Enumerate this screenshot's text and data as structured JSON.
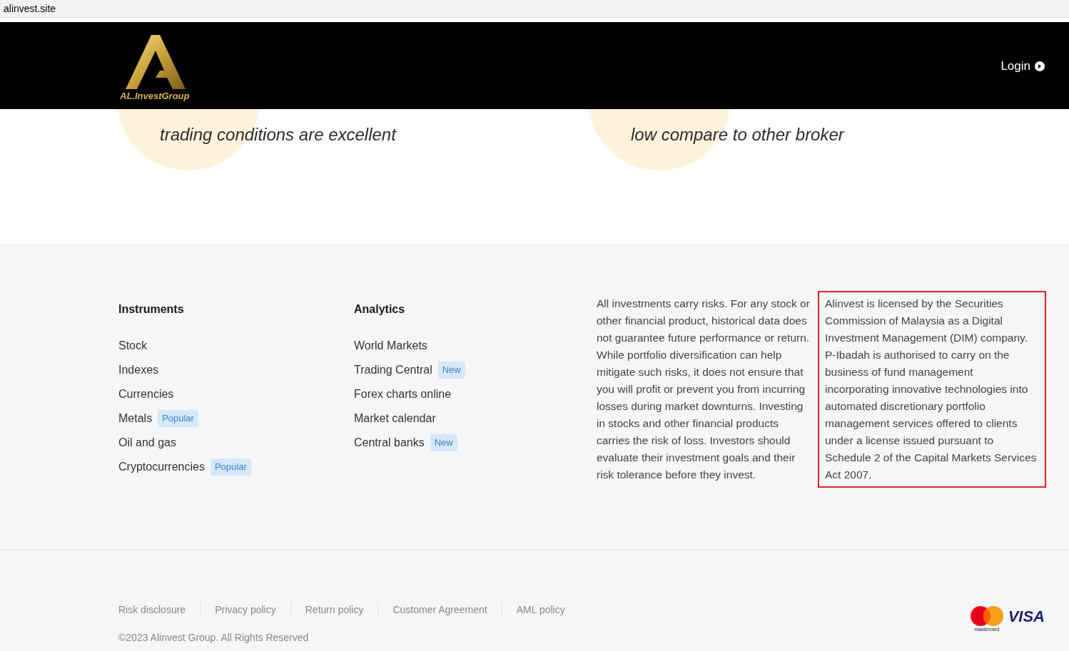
{
  "address_bar": {
    "url": "alinvest.site"
  },
  "header": {
    "logo_text": "AL.InvestGroup",
    "login": "Login"
  },
  "testimonials": [
    {
      "text": "trading conditions are excellent"
    },
    {
      "text": "low compare to other broker"
    }
  ],
  "footer": {
    "columns": [
      {
        "title": "Instruments",
        "items": [
          {
            "label": "Stock"
          },
          {
            "label": "Indexes"
          },
          {
            "label": "Currencies"
          },
          {
            "label": "Metals",
            "badge": "Popular"
          },
          {
            "label": "Oil and gas"
          },
          {
            "label": "Cryptocurrencies",
            "badge": "Popular"
          }
        ]
      },
      {
        "title": "Analytics",
        "items": [
          {
            "label": "World Markets"
          },
          {
            "label": "Trading Central",
            "badge": "New"
          },
          {
            "label": "Forex charts online"
          },
          {
            "label": "Market calendar"
          },
          {
            "label": "Central banks",
            "badge": "New"
          }
        ]
      }
    ],
    "notices": [
      {
        "text": "All investments carry risks. For any stock or other financial product, historical data does not guarantee future performance or return. While portfolio diversification can help mitigate such risks, it does not ensure that you will profit or prevent you from incurring losses during market downturns. Investing in stocks and other financial products carries the risk of loss. Investors should evaluate their investment goals and their risk tolerance before they invest.",
        "highlighted": false
      },
      {
        "text": "Alinvest is licensed by the Securities Commission of Malaysia as a Digital Investment Management (DIM) company. P-Ibadah is authorised to carry on the business of fund management incorporating innovative technologies into automated discretionary portfolio management services offered to clients under a license issued pursuant to Schedule 2 of the Capital Markets Services Act 2007.",
        "highlighted": true
      }
    ],
    "links": [
      "Risk disclosure",
      "Privacy policy",
      "Return policy",
      "Customer Agreement",
      "AML policy"
    ],
    "copyright": "©2023 Alinvest Group. All Rights Reserved",
    "payments": {
      "mastercard": "mastercard",
      "visa": "VISA"
    }
  }
}
